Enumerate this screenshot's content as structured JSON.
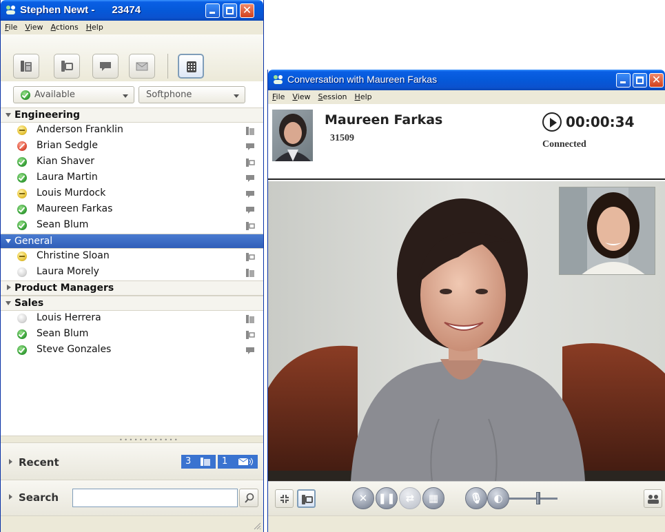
{
  "contacts_window": {
    "title": "Stephen Newt -      23474",
    "menu": [
      "File",
      "View",
      "Actions",
      "Help"
    ],
    "toolbar": [
      "phone-icon",
      "video-call-icon",
      "chat-icon",
      "email-icon",
      "dialpad-icon"
    ],
    "presence": {
      "value": "Available"
    },
    "device": {
      "value": "Softphone"
    },
    "groups": [
      {
        "name": "Engineering",
        "expanded": true,
        "selected": false,
        "contacts": [
          {
            "name": "Anderson Franklin",
            "status": "away",
            "icon": "phone-icon"
          },
          {
            "name": "Brian Sedgle",
            "status": "busy",
            "icon": "chat-icon"
          },
          {
            "name": "Kian Shaver",
            "status": "available",
            "icon": "video-call-icon"
          },
          {
            "name": "Laura Martin",
            "status": "available",
            "icon": "chat-icon"
          },
          {
            "name": "Louis Murdock",
            "status": "away",
            "icon": "chat-icon"
          },
          {
            "name": "Maureen Farkas",
            "status": "available",
            "icon": "chat-icon"
          },
          {
            "name": "Sean Blum",
            "status": "available",
            "icon": "video-call-icon"
          }
        ]
      },
      {
        "name": "General",
        "expanded": true,
        "selected": true,
        "contacts": [
          {
            "name": "Christine Sloan",
            "status": "away",
            "icon": "video-call-icon"
          },
          {
            "name": "Laura Morely",
            "status": "offline",
            "icon": "phone-icon"
          }
        ]
      },
      {
        "name": "Product Managers",
        "expanded": false,
        "selected": false,
        "contacts": []
      },
      {
        "name": "Sales",
        "expanded": true,
        "selected": false,
        "contacts": [
          {
            "name": "Louis Herrera",
            "status": "offline",
            "icon": "phone-icon"
          },
          {
            "name": "Sean Blum",
            "status": "available",
            "icon": "video-call-icon"
          },
          {
            "name": "Steve Gonzales",
            "status": "available",
            "icon": "chat-icon"
          }
        ]
      }
    ],
    "recent": {
      "label": "Recent",
      "missed_calls": "3",
      "voicemails": "1"
    },
    "search": {
      "label": "Search",
      "value": ""
    }
  },
  "conversation_window": {
    "title": "Conversation with Maureen Farkas",
    "menu": [
      "File",
      "View",
      "Session",
      "Help"
    ],
    "contact_name": "Maureen Farkas",
    "contact_extension": "31509",
    "timer": "00:00:34",
    "call_status": "Connected",
    "volume_level": 0.6,
    "colors": {
      "title_bar": "#0559d9",
      "selected_group": "#2f5eb8"
    }
  }
}
